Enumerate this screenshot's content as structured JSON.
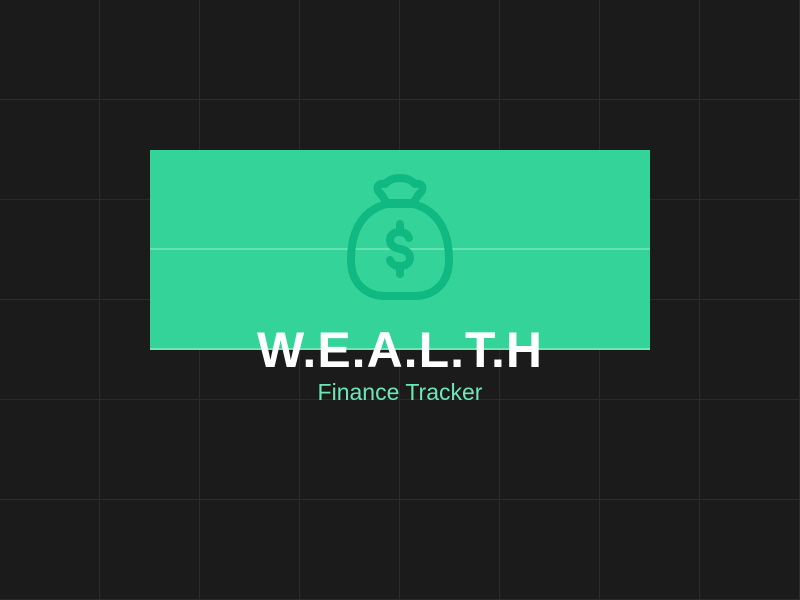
{
  "brand": {
    "title": "W.E.A.L.T.H",
    "subtitle": "Finance Tracker",
    "icon": "money-bag-icon"
  },
  "colors": {
    "background": "#1b1b1b",
    "banner": "#34d399",
    "icon": "#10b981",
    "subtitle": "#6ee7b7"
  }
}
